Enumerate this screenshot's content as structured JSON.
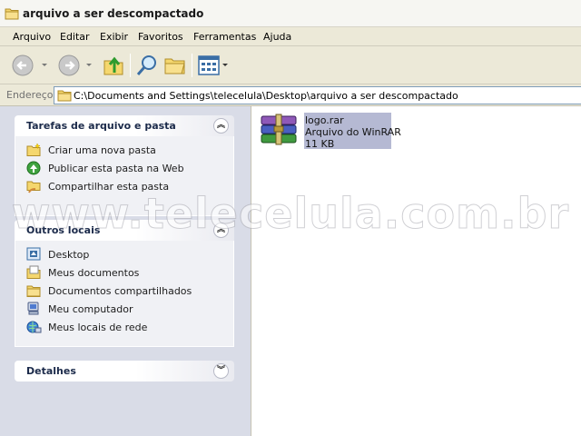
{
  "window": {
    "title": "arquivo a ser descompactado"
  },
  "menu": {
    "items": [
      "Arquivo",
      "Editar",
      "Exibir",
      "Favoritos",
      "Ferramentas",
      "Ajuda"
    ]
  },
  "toolbar": {
    "buttons": [
      "back-icon",
      "forward-icon",
      "up-folder-icon",
      "search-icon",
      "folders-icon",
      "views-icon"
    ]
  },
  "address": {
    "label": "Endereço",
    "path": "C:\\Documents and Settings\\telecelula\\Desktop\\arquivo a ser descompactado"
  },
  "tasks": {
    "file_tasks": {
      "title": "Tarefas de arquivo e pasta",
      "items": [
        {
          "label": "Criar uma nova pasta",
          "icon": "new-folder-icon"
        },
        {
          "label": "Publicar esta pasta na Web",
          "icon": "publish-web-icon"
        },
        {
          "label": "Compartilhar esta pasta",
          "icon": "share-folder-icon"
        }
      ]
    },
    "other_places": {
      "title": "Outros locais",
      "items": [
        {
          "label": "Desktop",
          "icon": "desktop-icon"
        },
        {
          "label": "Meus documentos",
          "icon": "my-documents-icon"
        },
        {
          "label": "Documentos compartilhados",
          "icon": "shared-documents-icon"
        },
        {
          "label": "Meu computador",
          "icon": "my-computer-icon"
        },
        {
          "label": "Meus locais de rede",
          "icon": "network-places-icon"
        }
      ]
    },
    "details": {
      "title": "Detalhes"
    }
  },
  "files": [
    {
      "name": "logo.rar",
      "type": "Arquivo do WinRAR",
      "size": "11 KB",
      "icon": "winrar-archive-icon"
    }
  ],
  "watermark": "www.telecelula.com.br",
  "colors": {
    "selection": "#b5b9d3",
    "panel_bg": "#f0f1f5",
    "left_pane_bg": "#d9dce7"
  }
}
